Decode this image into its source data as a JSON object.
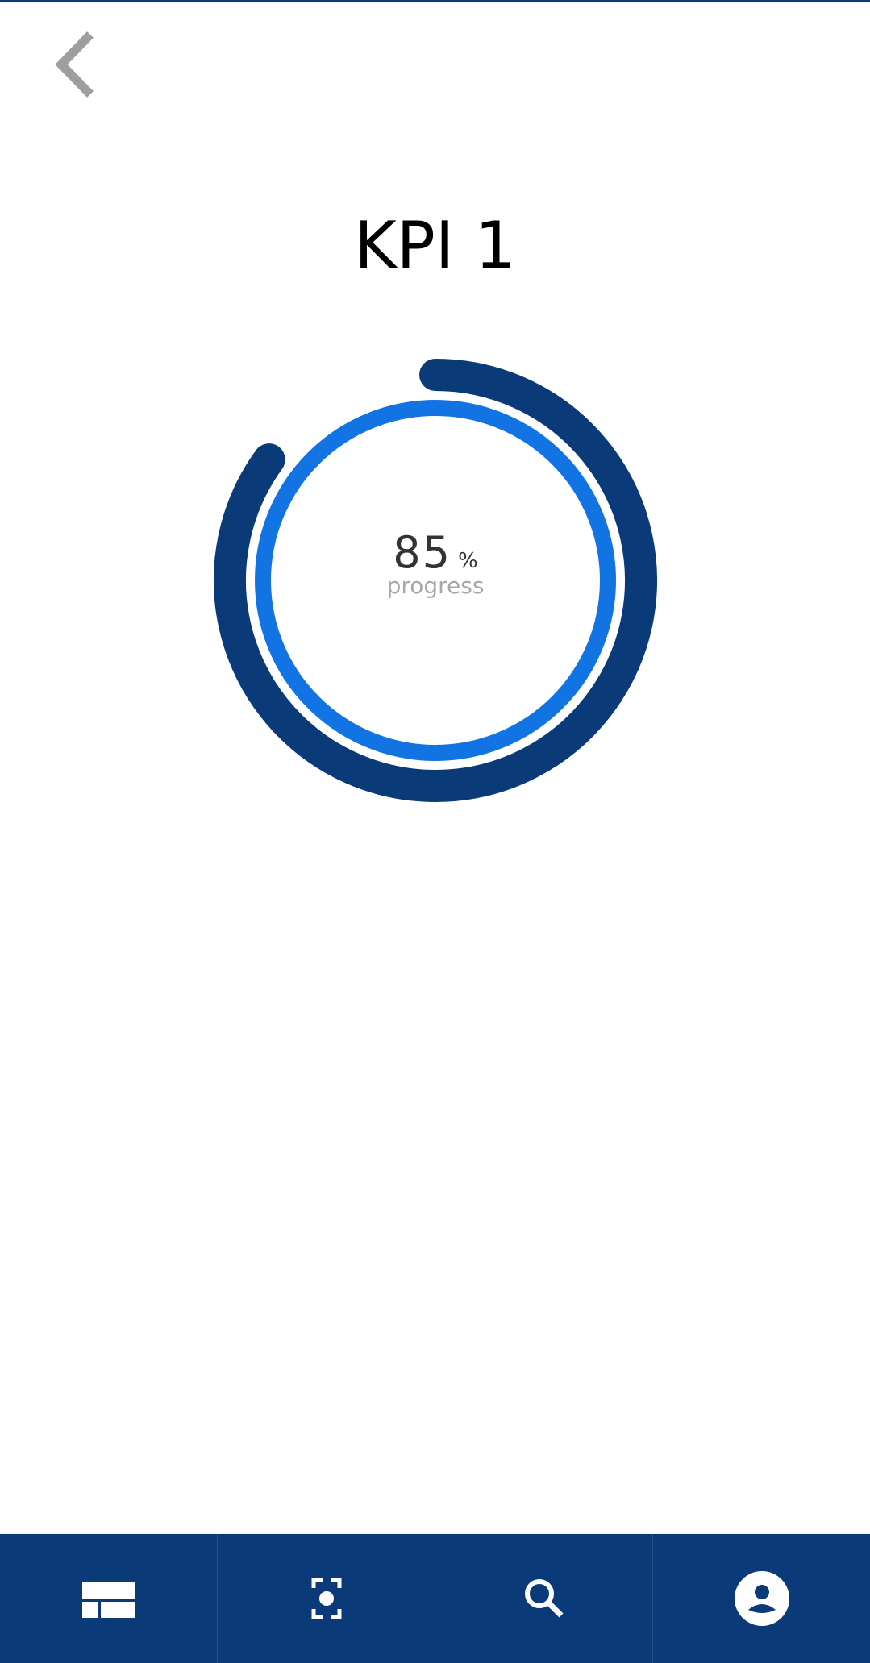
{
  "colors": {
    "primary_dark": "#0a3a78",
    "progress_blue": "#1273e3",
    "back_arrow": "#9e9e9e",
    "title": "#000000",
    "value_text": "#333333",
    "label_text": "#a8a8a8",
    "nav_icon": "#ffffff"
  },
  "header": {
    "back_icon": "chevron-left-icon"
  },
  "page": {
    "title": "KPI 1"
  },
  "gauge": {
    "value": "85",
    "unit": "%",
    "label": "progress",
    "progress_fraction": 0.85
  },
  "bottom_nav": {
    "items": [
      {
        "icon": "dashboard-icon"
      },
      {
        "icon": "scan-icon"
      },
      {
        "icon": "search-icon"
      },
      {
        "icon": "account-icon"
      }
    ]
  }
}
